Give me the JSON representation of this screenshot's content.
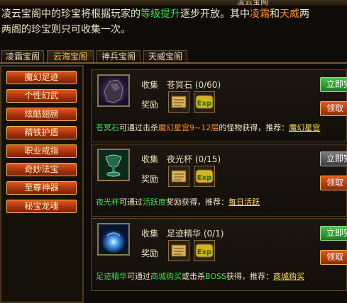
{
  "window": {
    "title": "凌云宝阁"
  },
  "description": {
    "line1_pre": "凌云宝阁中的珍宝将根据玩家的",
    "line1_hl": "等级提升",
    "line1_mid": "逐步开放。其中",
    "line1_hl2": "凌霜",
    "line1_and": "和",
    "line1_hl3": "天威",
    "line1_post": "两",
    "line2": "两阁的珍宝则只可收集一次。"
  },
  "tabs": [
    {
      "label": "凌霜宝阁",
      "active": false
    },
    {
      "label": "云海宝阁",
      "active": true
    },
    {
      "label": "神兵宝阁",
      "active": false
    },
    {
      "label": "天威宝阁",
      "active": false
    }
  ],
  "sidebar": {
    "items": [
      {
        "label": "魔幻足迹"
      },
      {
        "label": "个性幻武"
      },
      {
        "label": "炫酷翅膀"
      },
      {
        "label": "精铁护盾"
      },
      {
        "label": "职业戒指"
      },
      {
        "label": "奇妙法宝"
      },
      {
        "label": "至尊神器"
      },
      {
        "label": "秘宝龙魂"
      }
    ]
  },
  "cards": [
    {
      "collect_label": "收集",
      "name": "苍冥石 (0/60)",
      "reward_label": "奖励",
      "claim_label": "立即完",
      "claim_state": "active",
      "get_label": "领取",
      "hint_item": "苍冥石",
      "hint_text1": "可通过击杀",
      "hint_loc": "魔幻星宫9~12层",
      "hint_text2": "的怪物获得，推荐：",
      "hint_link": "魔幻星宫",
      "icon": "dark-stone-icon"
    },
    {
      "collect_label": "收集",
      "name": "夜光杯 (0/15)",
      "reward_label": "奖励",
      "claim_label": "立即完",
      "claim_state": "disabled",
      "get_label": "领取",
      "hint_item": "夜光杯",
      "hint_text1": "可通过",
      "hint_loc": "活跃度",
      "hint_text2": "奖励获得，推荐：",
      "hint_link": "每日活跃",
      "icon": "glowing-cup-icon"
    },
    {
      "collect_label": "收集",
      "name": "足迹精华 (0/1)",
      "reward_label": "奖励",
      "claim_label": "立即完",
      "claim_state": "active",
      "get_label": "领取",
      "hint_item": "足迹精华",
      "hint_text1": "可通过",
      "hint_loc": "商城购买",
      "hint_text2": "或击杀",
      "hint_loc2": "BOSS",
      "hint_text3": "获得，推荐：",
      "hint_link": "商城购买",
      "icon": "blue-essence-icon"
    }
  ],
  "colors": {
    "accent_green": "#35e24b",
    "accent_orange": "#ff8f2a",
    "link_yellow": "#ffe15a",
    "button_orange": "#e0581e"
  }
}
